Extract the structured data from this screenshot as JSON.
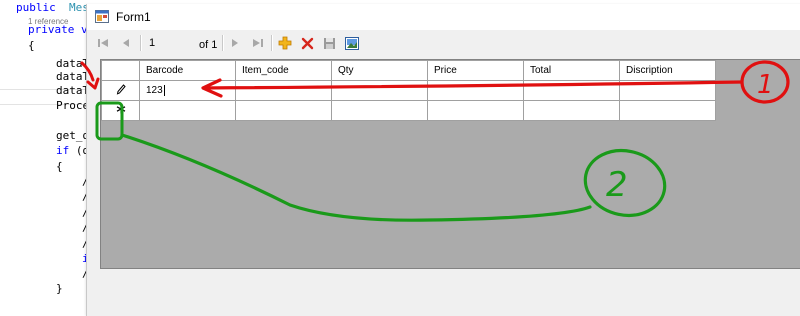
{
  "editor": {
    "lines": [
      {
        "parts": [
          {
            "cls": "kw",
            "t": "public"
          },
          {
            "cls": "",
            "t": "  "
          },
          {
            "cls": "type",
            "t": "Mes"
          }
        ]
      },
      {
        "parts": [
          {
            "cls": "kw",
            "t": "private"
          },
          {
            "cls": "",
            "t": " "
          },
          {
            "cls": "kw",
            "t": "v"
          }
        ]
      },
      {
        "parts": [
          {
            "cls": "",
            "t": "{"
          }
        ]
      },
      {
        "parts": [
          {
            "cls": "",
            "t": "dataT"
          }
        ]
      },
      {
        "parts": [
          {
            "cls": "",
            "t": "dataT"
          }
        ]
      },
      {
        "parts": [
          {
            "cls": "",
            "t": "dataT"
          }
        ]
      },
      {
        "parts": [
          {
            "cls": "",
            "t": "Proce"
          }
        ]
      },
      {
        "parts": [
          {
            "cls": "",
            "t": "get_d"
          }
        ]
      },
      {
        "parts": [
          {
            "cls": "kw",
            "t": "if"
          },
          {
            "cls": "",
            "t": " (d"
          }
        ]
      },
      {
        "parts": [
          {
            "cls": "",
            "t": "{"
          }
        ]
      },
      {
        "parts": [
          {
            "cls": "",
            "t": "/"
          }
        ]
      },
      {
        "parts": [
          {
            "cls": "",
            "t": "/"
          }
        ]
      },
      {
        "parts": [
          {
            "cls": "",
            "t": "/"
          }
        ]
      },
      {
        "parts": [
          {
            "cls": "",
            "t": "/"
          }
        ]
      },
      {
        "parts": [
          {
            "cls": "",
            "t": "/"
          }
        ]
      },
      {
        "parts": [
          {
            "cls": "kw",
            "t": "i"
          }
        ]
      },
      {
        "parts": [
          {
            "cls": "",
            "t": "/"
          }
        ]
      },
      {
        "parts": [
          {
            "cls": "",
            "t": "}"
          }
        ]
      }
    ],
    "references": "1 reference"
  },
  "form": {
    "title": "Form1"
  },
  "navigator": {
    "position": "1",
    "count_label": "of 1",
    "icons": [
      "move-first-icon",
      "move-previous-icon",
      "move-next-icon",
      "move-last-icon",
      "add-new-icon",
      "delete-icon",
      "save-icon",
      "image-icon"
    ]
  },
  "grid": {
    "columns": [
      "Barcode",
      "Item_code",
      "Qty",
      "Price",
      "Total",
      "Discription"
    ],
    "rows": [
      {
        "indicator": "pencil-icon",
        "cells": [
          "123",
          "",
          "",
          "",
          "",
          ""
        ]
      },
      {
        "indicator": "new-row-star-icon",
        "cells": [
          "",
          "",
          "",
          "",
          "",
          ""
        ]
      }
    ]
  },
  "annotations": {
    "label_1": "1",
    "label_2": "2",
    "red": "#e01010",
    "green": "#1a9a1a"
  }
}
